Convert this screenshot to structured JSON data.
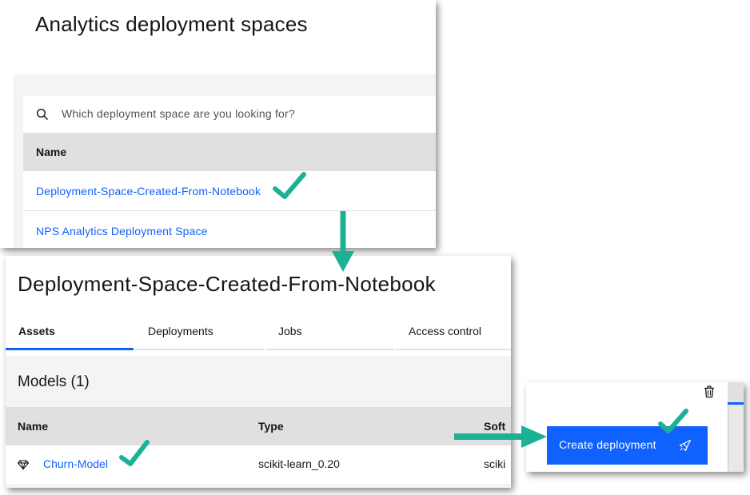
{
  "spaces_panel": {
    "title": "Analytics deployment spaces",
    "search": {
      "placeholder": "Which deployment space are you looking for?"
    },
    "table_header": "Name",
    "rows": [
      {
        "label": "Deployment-Space-Created-From-Notebook"
      },
      {
        "label": "NPS Analytics Deployment Space"
      }
    ]
  },
  "space_panel": {
    "title": "Deployment-Space-Created-From-Notebook",
    "tabs": [
      {
        "label": "Assets",
        "active": true
      },
      {
        "label": "Deployments"
      },
      {
        "label": "Jobs"
      },
      {
        "label": "Access control"
      }
    ],
    "models_title": "Models (1)",
    "columns": [
      "Name",
      "Type",
      "Soft"
    ],
    "model_row": {
      "name": "Churn-Model",
      "type": "scikit-learn_0.20",
      "software": "sciki"
    }
  },
  "deploy_panel": {
    "button_label": "Create deployment"
  },
  "icons": {
    "search": "search-icon",
    "model": "diamond-model-icon",
    "trash": "trash-icon",
    "rocket": "rocket-icon",
    "check": "checkmark-icon",
    "arrow": "arrow-icon"
  },
  "colors": {
    "accent": "#0f62fe",
    "annotation": "#1bb193",
    "header_gray": "#e0e0e0",
    "background_gray": "#f4f4f4"
  }
}
